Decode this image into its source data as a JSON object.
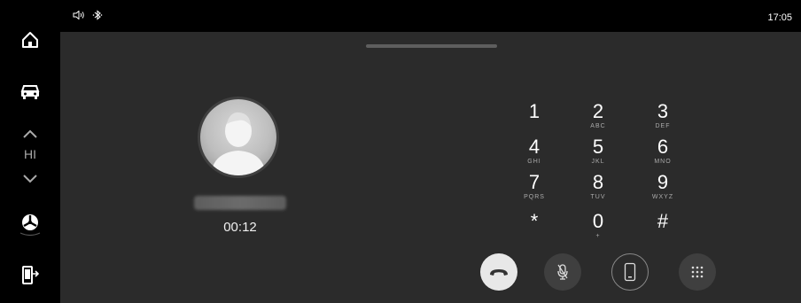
{
  "status": {
    "time": "17:05",
    "icons": [
      "volume-icon",
      "bluetooth-icon"
    ]
  },
  "sidebar": {
    "items": [
      "home-icon",
      "car-icon",
      "temp-up-icon",
      "temp-down-icon",
      "fan-icon",
      "phone-transfer-icon"
    ],
    "temp_label": "HI"
  },
  "call": {
    "duration": "00:12"
  },
  "keypad": {
    "keys": [
      {
        "digit": "1",
        "letters": ""
      },
      {
        "digit": "2",
        "letters": "ABC"
      },
      {
        "digit": "3",
        "letters": "DEF"
      },
      {
        "digit": "4",
        "letters": "GHI"
      },
      {
        "digit": "5",
        "letters": "JKL"
      },
      {
        "digit": "6",
        "letters": "MNO"
      },
      {
        "digit": "7",
        "letters": "PQRS"
      },
      {
        "digit": "8",
        "letters": "TUV"
      },
      {
        "digit": "9",
        "letters": "WXYZ"
      },
      {
        "digit": "*",
        "letters": ""
      },
      {
        "digit": "0",
        "letters": "+"
      },
      {
        "digit": "#",
        "letters": ""
      }
    ]
  },
  "actions": [
    "end-call-icon",
    "mute-mic-icon",
    "handset-icon",
    "keypad-grid-icon"
  ],
  "colors": {
    "end_call": "#e8e8e8",
    "panel": "#2b2b2b",
    "button": "#3f3f3f"
  }
}
